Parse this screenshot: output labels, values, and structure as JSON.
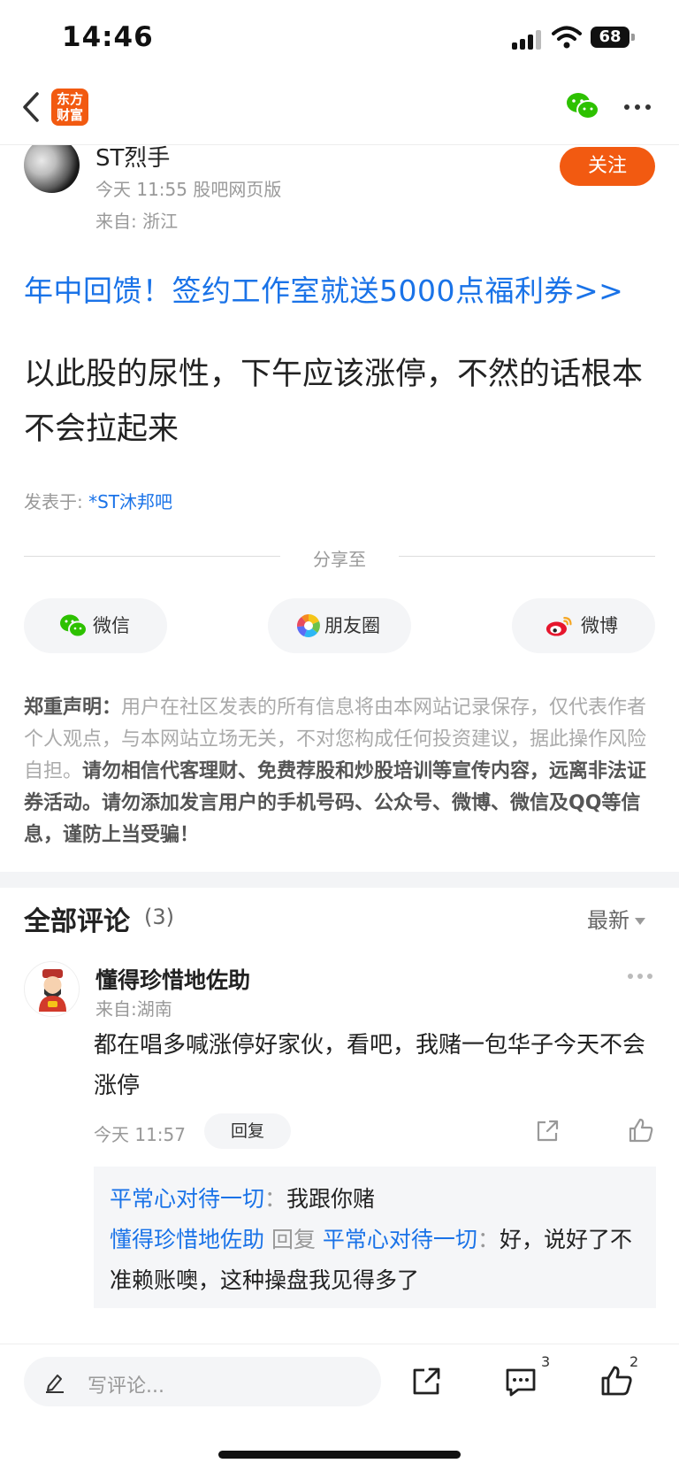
{
  "status_bar": {
    "time": "14:46",
    "battery": "68"
  },
  "nav": {
    "logo_line1": "东方",
    "logo_line2": "财富"
  },
  "author": {
    "name": "ST烈手",
    "time_source": "今天 11:55 股吧网页版",
    "location": "来自: 浙江",
    "follow_label": "关注"
  },
  "promo": {
    "text": "年中回馈！签约工作室就送5000点福利券>>"
  },
  "post": {
    "body": "以此股的尿性，下午应该涨停，不然的话根本不会拉起来",
    "posted_in_label": "发表于: ",
    "forum": "*ST沐邦吧"
  },
  "share": {
    "title": "分享至",
    "wechat": "微信",
    "moments": "朋友圈",
    "weibo": "微博"
  },
  "disclaimer": {
    "label": "郑重声明：",
    "text": "用户在社区发表的所有信息将由本网站记录保存，仅代表作者个人观点，与本网站立场无关，不对您构成任何投资建议，据此操作风险自担。",
    "warning": "请勿相信代客理财、免费荐股和炒股培训等宣传内容，远离非法证券活动。请勿添加发言用户的手机号码、公众号、微博、微信及QQ等信息，谨防上当受骗！"
  },
  "comments": {
    "title": "全部评论",
    "count": "(3)",
    "sort": "最新",
    "items": [
      {
        "user": "懂得珍惜地佐助",
        "location": "来自:湖南",
        "text": "都在唱多喊涨停好家伙，看吧，我赌一包华子今天不会涨停",
        "time": "今天 11:57",
        "reply_label": "回复",
        "replies": [
          {
            "user": "平常心对待一切",
            "sep": "：",
            "text": "我跟你赌"
          },
          {
            "user": "懂得珍惜地佐助",
            "mid": " 回复 ",
            "target": "平常心对待一切",
            "sep": "：",
            "text": "好，说好了不准赖账噢，这种操盘我见得多了"
          }
        ]
      }
    ]
  },
  "bottom_bar": {
    "placeholder": "写评论...",
    "comment_count": "3",
    "like_count": "2"
  },
  "colors": {
    "accent": "#f25a11",
    "link": "#1a73e8"
  }
}
